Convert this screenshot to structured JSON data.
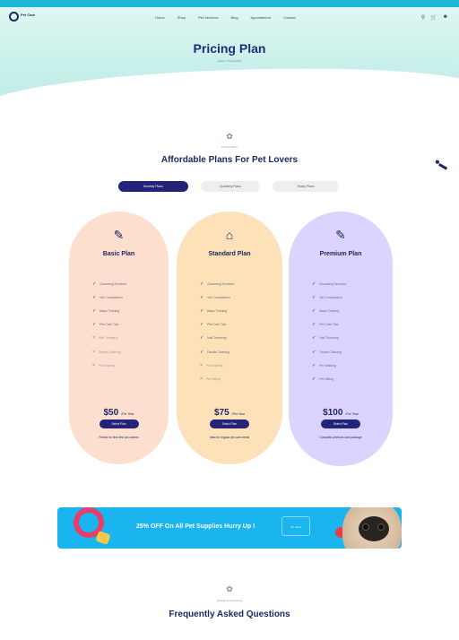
{
  "hero": {
    "title": "Pricing Plan",
    "breadcrumb": "Home  /  Pricing Plan"
  },
  "brand": {
    "name": "Pet Care",
    "accent": "#24237a",
    "topbar": "#1fb7d6"
  },
  "nav": {
    "items": [
      "Home",
      "Shop",
      "Pet Services",
      "Blog",
      "Appointment",
      "Contact"
    ],
    "icons": [
      "search-icon",
      "cart-icon",
      "user-icon"
    ]
  },
  "pricing": {
    "subtitle": "Pricing Plans",
    "title": "Affordable Plans For Pet Lovers",
    "tabs": [
      "Monthly Plans",
      "Quarterly Plans",
      "Yearly Plans"
    ],
    "plans": [
      {
        "name": "Basic Plan",
        "icon": "pencil-icon",
        "features": [
          "Grooming Services",
          "Vet Consultation",
          "Basic Training",
          "Pet Care Tips",
          "Nail Trimming",
          "Dental Cleaning",
          "Pet Walking"
        ],
        "price": "$50",
        "period": "/Per Year",
        "button": "Select Plan",
        "note": "Perfect for first-time pet owners"
      },
      {
        "name": "Standard Plan",
        "icon": "house-icon",
        "features": [
          "Grooming Services",
          "Vet Consultation",
          "Basic Training",
          "Pet Care Tips",
          "Nail Trimming",
          "Dental Cleaning",
          "Pet Walking",
          "Pet Sitting"
        ],
        "price": "$75",
        "period": "/Per Year",
        "button": "Select Plan",
        "note": "Ideal for regular pet care needs"
      },
      {
        "name": "Premium Plan",
        "icon": "pencil-icon",
        "features": [
          "Grooming Services",
          "Vet Consultation",
          "Basic Training",
          "Pet Care Tips",
          "Nail Trimming",
          "Dental Cleaning",
          "Pet Walking",
          "Pet Sitting"
        ],
        "price": "$100",
        "period": "/Per Year",
        "button": "Select Plan",
        "note": "Complete premium care package"
      }
    ]
  },
  "promo": {
    "text": "25% OFF On All Pet Supplies Hurry Up !",
    "stamp": "Pet Store"
  },
  "faq": {
    "subtitle": "Questions & Answers",
    "title": "Frequently Asked Questions"
  }
}
